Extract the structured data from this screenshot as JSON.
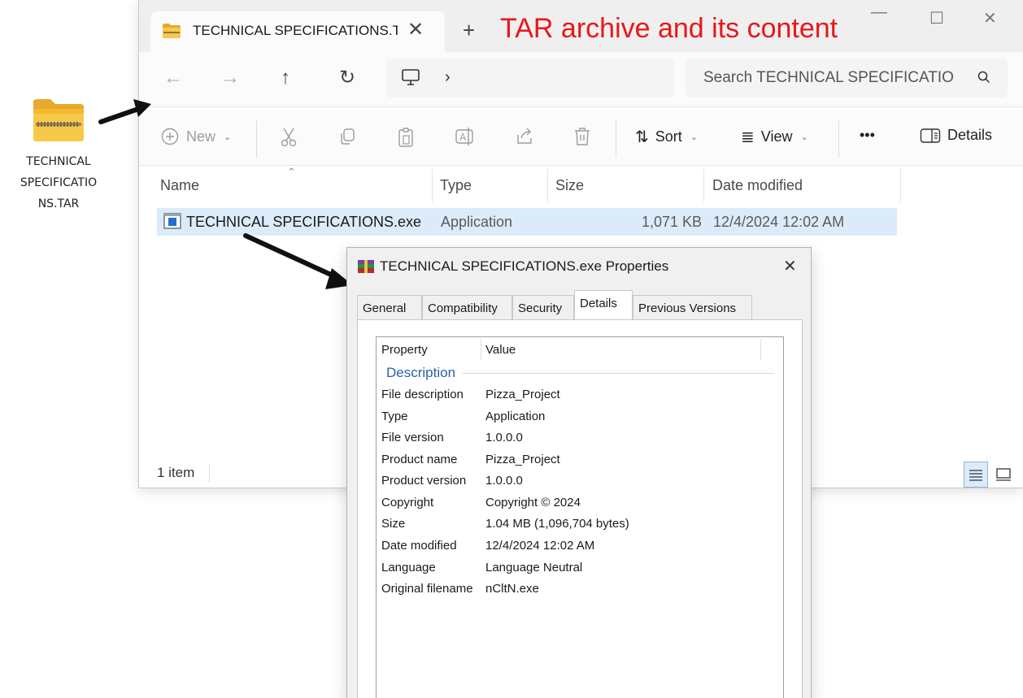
{
  "desktop": {
    "file_label_lines": [
      "TECHNICAL",
      "SPECIFICATIO",
      "NS.TAR"
    ]
  },
  "annotation": "TAR archive and its content",
  "explorer": {
    "tab_title": "TECHNICAL SPECIFICATIONS.TAR",
    "tab_close": "✕",
    "new_tab": "+",
    "search_placeholder": "Search TECHNICAL SPECIFICATIO",
    "toolbar": {
      "new": "New",
      "sort": "Sort",
      "view": "View",
      "more": "•••",
      "details": "Details"
    },
    "columns": [
      "Name",
      "Type",
      "Size",
      "Date modified"
    ],
    "files": [
      {
        "name": "TECHNICAL SPECIFICATIONS.exe",
        "type": "Application",
        "size": "1,071 KB",
        "date": "12/4/2024 12:02 AM"
      }
    ],
    "status": "1 item"
  },
  "dialog": {
    "title": "TECHNICAL SPECIFICATIONS.exe Properties",
    "close": "✕",
    "tabs": [
      "General",
      "Compatibility",
      "Security",
      "Details",
      "Previous Versions"
    ],
    "active_tab": "Details",
    "header": {
      "property": "Property",
      "value": "Value"
    },
    "section": "Description",
    "rows": [
      {
        "key": "File description",
        "value": "Pizza_Project"
      },
      {
        "key": "Type",
        "value": "Application"
      },
      {
        "key": "File version",
        "value": "1.0.0.0"
      },
      {
        "key": "Product name",
        "value": "Pizza_Project"
      },
      {
        "key": "Product version",
        "value": "1.0.0.0"
      },
      {
        "key": "Copyright",
        "value": "Copyright ©  2024"
      },
      {
        "key": "Size",
        "value": "1.04 MB (1,096,704 bytes)"
      },
      {
        "key": "Date modified",
        "value": "12/4/2024 12:02 AM"
      },
      {
        "key": "Language",
        "value": "Language Neutral"
      },
      {
        "key": "Original filename",
        "value": "nCltN.exe"
      }
    ]
  },
  "colors": {
    "annotation": "#e8161b",
    "selection": "#dcebfa",
    "section_link": "#2e5ea8",
    "folder": "#f5c744"
  }
}
